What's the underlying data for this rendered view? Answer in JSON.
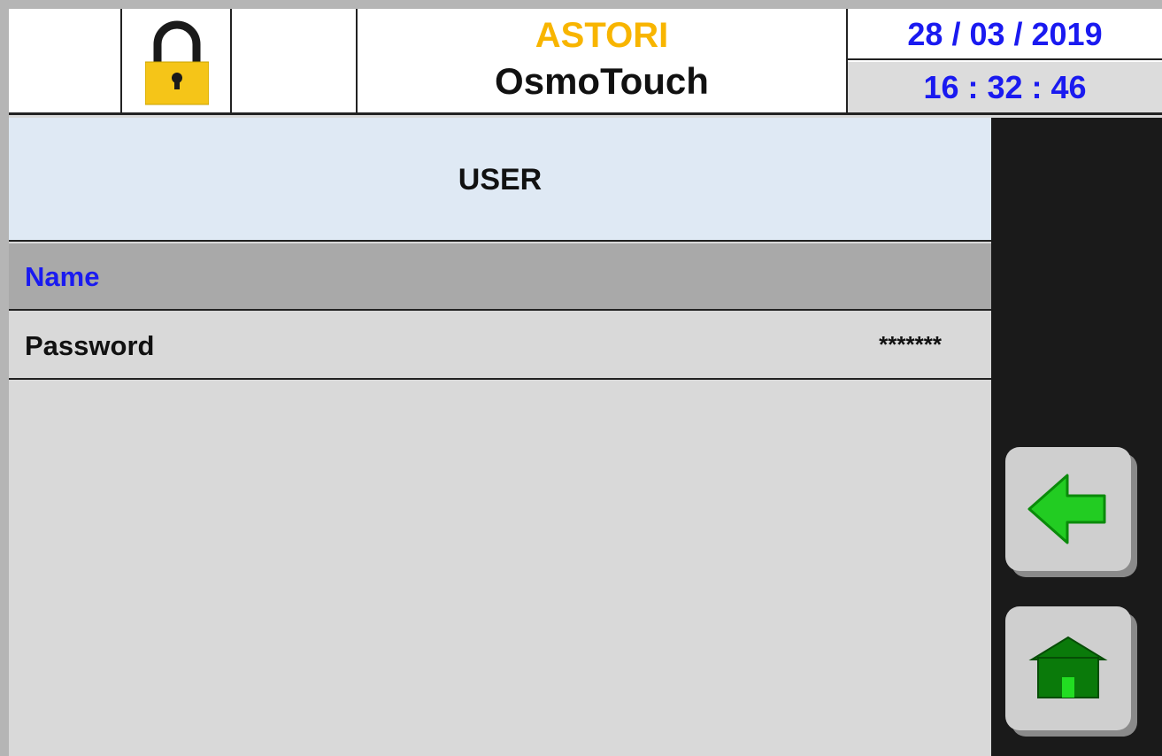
{
  "header": {
    "brand": "ASTORI",
    "product": "OsmoTouch",
    "date": "28 / 03 / 2019",
    "time": "16 : 32 : 46",
    "lock_icon": "padlock-locked-icon"
  },
  "content": {
    "section_title": "USER",
    "rows": [
      {
        "label": "Name",
        "value": ""
      },
      {
        "label": "Password",
        "value": "*******"
      }
    ]
  },
  "side_panel": {
    "back_icon": "arrow-left-icon",
    "home_icon": "home-icon"
  },
  "colors": {
    "brand": "#f8b500",
    "date_time": "#1a1af0",
    "selected_row_label": "#1a1af0",
    "selected_row_bg": "#a9a9a9",
    "title_bar_bg": "#dfe9f4",
    "lock_body": "#f5c518",
    "icon_green": "#22cc22",
    "home_green": "#0a7a0a",
    "side_panel": "#1a1a1a"
  }
}
